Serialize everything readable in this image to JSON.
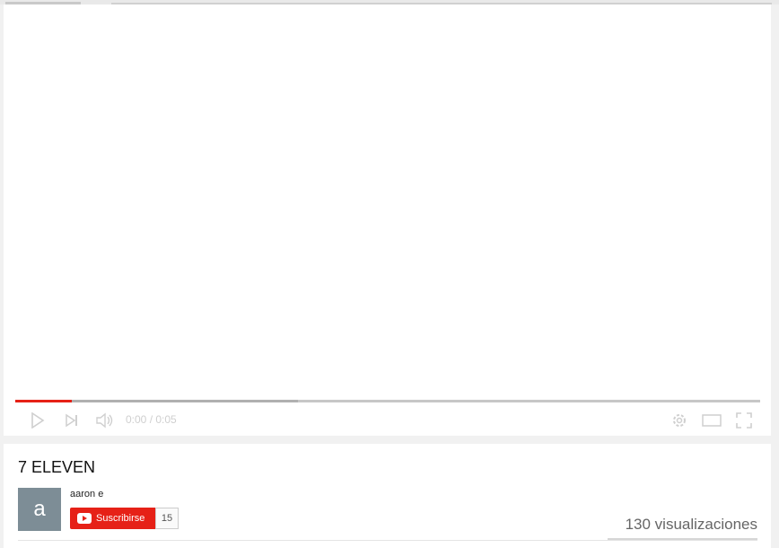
{
  "player": {
    "current_time": "0:00",
    "separator": " / ",
    "duration": "0:05",
    "progress_fraction": 0.076,
    "buffered_fraction": 0.38,
    "accent_color": "#e62117"
  },
  "icons": {
    "play": "play-icon",
    "next": "next-icon",
    "volume": "volume-icon",
    "settings": "gear-icon",
    "theater": "theater-mode-icon",
    "fullscreen": "fullscreen-icon"
  },
  "video": {
    "title": "7 ELEVEN",
    "views": "130 visualizaciones"
  },
  "channel": {
    "avatar_letter": "a",
    "avatar_color": "#7d8d96",
    "name": "aaron e",
    "subscribe_label": "Suscribirse",
    "subscriber_count": "15"
  }
}
